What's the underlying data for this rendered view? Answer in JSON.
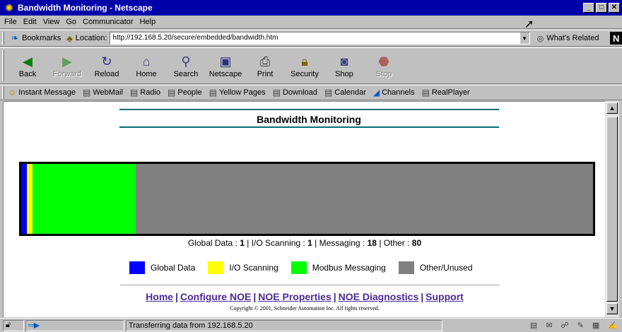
{
  "window": {
    "title": "Bandwidth Monitoring - Netscape",
    "icon": "netscape-star-icon",
    "controls": [
      "minimize",
      "maximize",
      "close"
    ]
  },
  "menu": {
    "items": [
      {
        "label": "File"
      },
      {
        "label": "Edit"
      },
      {
        "label": "View"
      },
      {
        "label": "Go"
      },
      {
        "label": "Communicator"
      },
      {
        "label": "Help"
      }
    ]
  },
  "location_bar": {
    "bookmarks_label": "Bookmarks",
    "location_label": "Location:",
    "url": "http://192.168.5.20/secure/embedded/bandwidth.htm",
    "related_label": "What's Related"
  },
  "nav_toolbar": {
    "buttons": [
      {
        "label": "Back",
        "icon": "back-arrow-icon",
        "enabled": true
      },
      {
        "label": "Forward",
        "icon": "forward-arrow-icon",
        "enabled": false
      },
      {
        "label": "Reload",
        "icon": "reload-icon",
        "enabled": true
      },
      {
        "label": "Home",
        "icon": "home-icon",
        "enabled": true
      },
      {
        "label": "Search",
        "icon": "search-icon",
        "enabled": true
      },
      {
        "label": "Netscape",
        "icon": "netscape-icon",
        "enabled": true
      },
      {
        "label": "Print",
        "icon": "print-icon",
        "enabled": true
      },
      {
        "label": "Security",
        "icon": "lock-icon",
        "enabled": true
      },
      {
        "label": "Shop",
        "icon": "shop-icon",
        "enabled": true
      },
      {
        "label": "Stop",
        "icon": "stop-icon",
        "enabled": false
      }
    ]
  },
  "personal_toolbar": {
    "items": [
      {
        "label": "Instant Message",
        "icon": "person-icon"
      },
      {
        "label": "WebMail",
        "icon": "bookmark-page-icon"
      },
      {
        "label": "Radio",
        "icon": "bookmark-page-icon"
      },
      {
        "label": "People",
        "icon": "bookmark-page-icon"
      },
      {
        "label": "Yellow Pages",
        "icon": "bookmark-page-icon"
      },
      {
        "label": "Download",
        "icon": "bookmark-page-icon"
      },
      {
        "label": "Calendar",
        "icon": "bookmark-page-icon"
      },
      {
        "label": "Channels",
        "icon": "channels-icon"
      },
      {
        "label": "RealPlayer",
        "icon": "bookmark-page-icon"
      }
    ]
  },
  "page": {
    "title": "Bandwidth Monitoring",
    "bandwidth": [
      {
        "name": "Global Data",
        "summary_label": "Global Data",
        "value": 1,
        "color": "#0000ff"
      },
      {
        "name": "I/O Scanning",
        "summary_label": "I/O Scanning",
        "value": 1,
        "color": "#ffff00"
      },
      {
        "name": "Modbus Messaging",
        "summary_label": "Messaging",
        "value": 18,
        "color": "#00ff00"
      },
      {
        "name": "Other/Unused",
        "summary_label": "Other",
        "value": 80,
        "color": "#808080"
      }
    ],
    "links": [
      "Home",
      "Configure NOE",
      "NOE Properties",
      "NOE Diagnostics",
      "Support"
    ],
    "link_separator": "|",
    "copyright": "Copyright © 2001, Schneider Automation Inc. All rights reserved."
  },
  "status_bar": {
    "text": "Transferring data from 192.168.5.20"
  }
}
